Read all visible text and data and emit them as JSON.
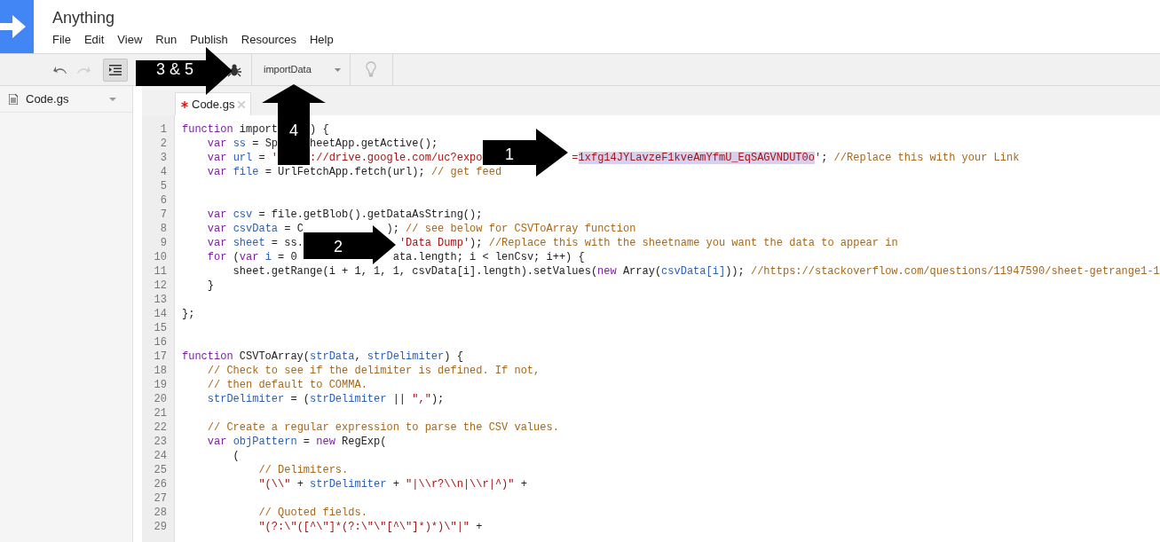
{
  "app": {
    "title": "Anything",
    "menu": [
      "File",
      "Edit",
      "View",
      "Run",
      "Publish",
      "Resources",
      "Help"
    ]
  },
  "toolbar": {
    "undo": {
      "disabled": false
    },
    "redo": {
      "disabled": true
    },
    "indent": {
      "on": true
    },
    "function_select": "importData"
  },
  "sidebar": {
    "files": [
      {
        "name": "Code.gs"
      }
    ]
  },
  "tabs": [
    {
      "label": "Code.gs",
      "selected": true,
      "modified": true
    }
  ],
  "editor": {
    "lines": [
      {
        "number": "1",
        "segments": [
          [
            {
              "kind": "keyword",
              "text": "function"
            },
            {
              "kind": "text",
              "text": " import"
            }
          ],
          [
            {
              "kind": "text",
              "text": "     ) {"
            }
          ]
        ]
      },
      {
        "number": "2",
        "segments": [
          [
            {
              "kind": "keyword",
              "text": "    var "
            },
            {
              "kind": "variable",
              "text": "ss"
            },
            {
              "kind": "text",
              "text": " = Sp"
            }
          ],
          [
            {
              "kind": "text",
              "text": "     heetApp.getActive();"
            }
          ]
        ]
      },
      {
        "number": "3",
        "segments": [
          [
            {
              "kind": "keyword",
              "text": "    var "
            },
            {
              "kind": "variable",
              "text": "url"
            },
            {
              "kind": "text",
              "text": " = "
            },
            {
              "kind": "string",
              "text": "'"
            }
          ],
          [
            {
              "kind": "string",
              "text": "     ://drive.google.com/uc?expo"
            }
          ],
          [
            {
              "kind": "string",
              "text": "              ="
            },
            {
              "kind": "highlight",
              "text": "1xfg14JYLavzeF1kveAmYfmU_EqSAGVNDUT0o"
            },
            {
              "kind": "string",
              "text": "'"
            },
            {
              "kind": "text",
              "text": "; "
            },
            {
              "kind": "comment",
              "text": "//Replace this with your Link"
            }
          ]
        ]
      },
      {
        "number": "4",
        "segments": [
          [
            {
              "kind": "keyword",
              "text": "    var "
            },
            {
              "kind": "variable",
              "text": "file"
            },
            {
              "kind": "text",
              "text": " = UrlFetchApp.fetch(url); "
            },
            {
              "kind": "comment",
              "text": "// get feed"
            }
          ]
        ]
      },
      {
        "number": "5"
      },
      {
        "number": "6"
      },
      {
        "number": "7",
        "segments": [
          [
            {
              "kind": "keyword",
              "text": "    var "
            },
            {
              "kind": "variable",
              "text": "csv"
            },
            {
              "kind": "text",
              "text": " = file.getBlob().getDataAsString();"
            }
          ]
        ]
      },
      {
        "number": "8",
        "segments": [
          [
            {
              "kind": "keyword",
              "text": "    var "
            },
            {
              "kind": "variable",
              "text": "csvData"
            },
            {
              "kind": "text",
              "text": " = C"
            }
          ],
          [
            {
              "kind": "text",
              "text": "             ); "
            },
            {
              "kind": "comment",
              "text": "// see below for CSVToArray function"
            }
          ]
        ]
      },
      {
        "number": "9",
        "segments": [
          [
            {
              "kind": "keyword",
              "text": "    var "
            },
            {
              "kind": "variable",
              "text": "sheet"
            },
            {
              "kind": "text",
              "text": " = ss."
            }
          ],
          [
            {
              "kind": "string",
              "text": "               'Data Dump'"
            },
            {
              "kind": "text",
              "text": "); "
            },
            {
              "kind": "comment",
              "text": "//Replace this with the sheetname you want the data to appear in"
            }
          ]
        ]
      },
      {
        "number": "10",
        "segments": [
          [
            {
              "kind": "keyword",
              "text": "    for"
            },
            {
              "kind": "text",
              "text": " ("
            },
            {
              "kind": "keyword",
              "text": "var "
            },
            {
              "kind": "variable",
              "text": "i"
            },
            {
              "kind": "text",
              "text": " = 0"
            }
          ],
          [
            {
              "kind": "text",
              "text": "               ata.length; i < lenCsv; i++) {"
            }
          ]
        ]
      },
      {
        "number": "11",
        "segments": [
          [
            {
              "kind": "text",
              "text": "        sheet.getRange(i + 1, 1, 1, csvData[i].length).setValues("
            },
            {
              "kind": "keyword",
              "text": "new"
            },
            {
              "kind": "text",
              "text": " Array("
            },
            {
              "kind": "variable",
              "text": "csvData[i]"
            },
            {
              "kind": "text",
              "text": ")); "
            },
            {
              "kind": "comment",
              "text": "//https://stackoverflow.com/questions/11947590/sheet-getrange1-1"
            }
          ]
        ]
      },
      {
        "number": "12",
        "segments": [
          [
            {
              "kind": "text",
              "text": "    }"
            }
          ]
        ]
      },
      {
        "number": "13"
      },
      {
        "number": "14",
        "segments": [
          [
            {
              "kind": "text",
              "text": "};"
            }
          ]
        ]
      },
      {
        "number": "15"
      },
      {
        "number": "16"
      },
      {
        "number": "17",
        "segments": [
          [
            {
              "kind": "keyword",
              "text": "function"
            },
            {
              "kind": "text",
              "text": " CSVToArray("
            },
            {
              "kind": "variable",
              "text": "strData"
            },
            {
              "kind": "text",
              "text": ", "
            },
            {
              "kind": "variable",
              "text": "strDelimiter"
            },
            {
              "kind": "text",
              "text": ") {"
            }
          ]
        ]
      },
      {
        "number": "18",
        "segments": [
          [
            {
              "kind": "comment",
              "text": "    // Check to see if the delimiter is defined. If not,"
            }
          ]
        ]
      },
      {
        "number": "19",
        "segments": [
          [
            {
              "kind": "comment",
              "text": "    // then default to COMMA."
            }
          ]
        ]
      },
      {
        "number": "20",
        "segments": [
          [
            {
              "kind": "variable",
              "text": "    strDelimiter"
            },
            {
              "kind": "text",
              "text": " = ("
            },
            {
              "kind": "variable",
              "text": "strDelimiter"
            },
            {
              "kind": "text",
              "text": " || "
            },
            {
              "kind": "string",
              "text": "\",\""
            },
            {
              "kind": "text",
              "text": ");"
            }
          ]
        ]
      },
      {
        "number": "21"
      },
      {
        "number": "22",
        "segments": [
          [
            {
              "kind": "comment",
              "text": "    // Create a regular expression to parse the CSV values."
            }
          ]
        ]
      },
      {
        "number": "23",
        "segments": [
          [
            {
              "kind": "keyword",
              "text": "    var "
            },
            {
              "kind": "variable",
              "text": "objPattern"
            },
            {
              "kind": "text",
              "text": " = "
            },
            {
              "kind": "keyword",
              "text": "new"
            },
            {
              "kind": "text",
              "text": " RegExp("
            }
          ]
        ]
      },
      {
        "number": "24",
        "segments": [
          [
            {
              "kind": "text",
              "text": "        ("
            }
          ]
        ]
      },
      {
        "number": "25",
        "segments": [
          [
            {
              "kind": "comment",
              "text": "            // Delimiters."
            }
          ]
        ]
      },
      {
        "number": "26",
        "segments": [
          [
            {
              "kind": "string",
              "text": "            \"(\\\\\""
            },
            {
              "kind": "text",
              "text": " + "
            },
            {
              "kind": "variable",
              "text": "strDelimiter"
            },
            {
              "kind": "text",
              "text": " + "
            },
            {
              "kind": "string",
              "text": "\"|\\\\r?\\\\n|\\\\r|^)\""
            },
            {
              "kind": "text",
              "text": " +"
            }
          ]
        ]
      },
      {
        "number": "27"
      },
      {
        "number": "28",
        "segments": [
          [
            {
              "kind": "comment",
              "text": "            // Quoted fields."
            }
          ]
        ]
      },
      {
        "number": "29",
        "segments": [
          [
            {
              "kind": "string",
              "text": "            \"(?:\\\"([^\\\"]*(?:\\\"\\\"[^\\\"]*)*)\\\"|\""
            },
            {
              "kind": "text",
              "text": " +"
            }
          ]
        ]
      }
    ]
  },
  "callouts": [
    {
      "label": "3 & 5"
    },
    {
      "label": "4"
    },
    {
      "label": "1"
    },
    {
      "label": "2"
    }
  ]
}
